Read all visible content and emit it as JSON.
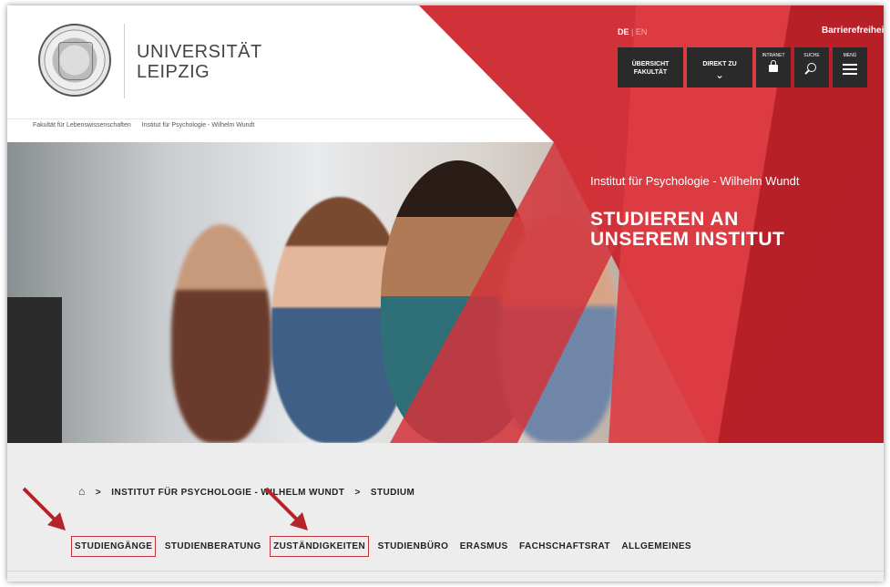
{
  "header": {
    "logo_line1": "UNIVERSITÄT",
    "logo_line2": "LEIPZIG",
    "breadcrumb_top": [
      "Fakultät für Lebenswissenschaften",
      "Institut für Psychologie - Wilhelm Wundt"
    ]
  },
  "topnav": {
    "lang_active": "DE",
    "lang_sep": "|",
    "lang_other": "EN",
    "accessibility": "Barrierefreiheit",
    "overview_line1": "ÜBERSICHT",
    "overview_line2": "FAKULTÄT",
    "direkt": "DIREKT ZU",
    "intranet": "INTRANET",
    "suche": "SUCHE",
    "menu": "MENÜ"
  },
  "hero": {
    "subtitle": "Institut für Psychologie - Wilhelm Wundt",
    "title_line1": "STUDIEREN AN",
    "title_line2": "UNSEREM INSTITUT"
  },
  "breadcrumb": {
    "sep": ">",
    "items": [
      "INSTITUT FÜR PSYCHOLOGIE - WILHELM WUNDT",
      "STUDIUM"
    ]
  },
  "tabs": [
    {
      "label": "STUDIENGÄNGE"
    },
    {
      "label": "STUDIENBERATUNG"
    },
    {
      "label": "ZUSTÄNDIGKEITEN"
    },
    {
      "label": "STUDIENBÜRO"
    },
    {
      "label": "ERASMUS"
    },
    {
      "label": "FACHSCHAFTSRAT"
    },
    {
      "label": "ALLGEMEINES"
    }
  ],
  "colors": {
    "brand_red": "#d0343a",
    "dark_button": "#2a2a2a",
    "annotation": "#c0343b"
  }
}
